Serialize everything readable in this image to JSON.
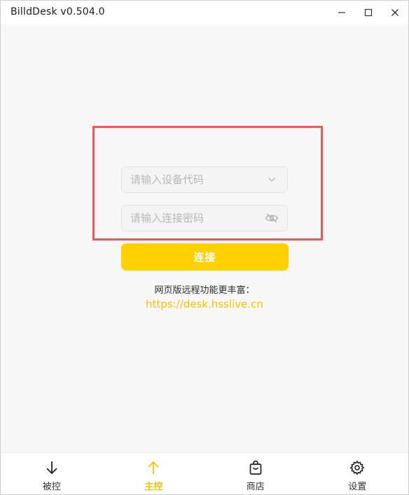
{
  "window": {
    "title": "BilldDesk v0.504.0"
  },
  "form": {
    "device_code_placeholder": "请输入设备代码",
    "password_placeholder": "请输入连接密码",
    "connect_label": "连接"
  },
  "web_info": {
    "note": "网页版远程功能更丰富：",
    "link": "https://desk.hsslive.cn"
  },
  "nav": {
    "items": [
      {
        "label": "被控",
        "icon": "arrow-down-icon"
      },
      {
        "label": "主控",
        "icon": "arrow-up-icon",
        "active": true
      },
      {
        "label": "商店",
        "icon": "shopping-bag-icon"
      },
      {
        "label": "设置",
        "icon": "gear-icon"
      }
    ]
  },
  "colors": {
    "accent": "#ffd100",
    "link": "#f2c200",
    "highlight": "#e85a5a"
  }
}
